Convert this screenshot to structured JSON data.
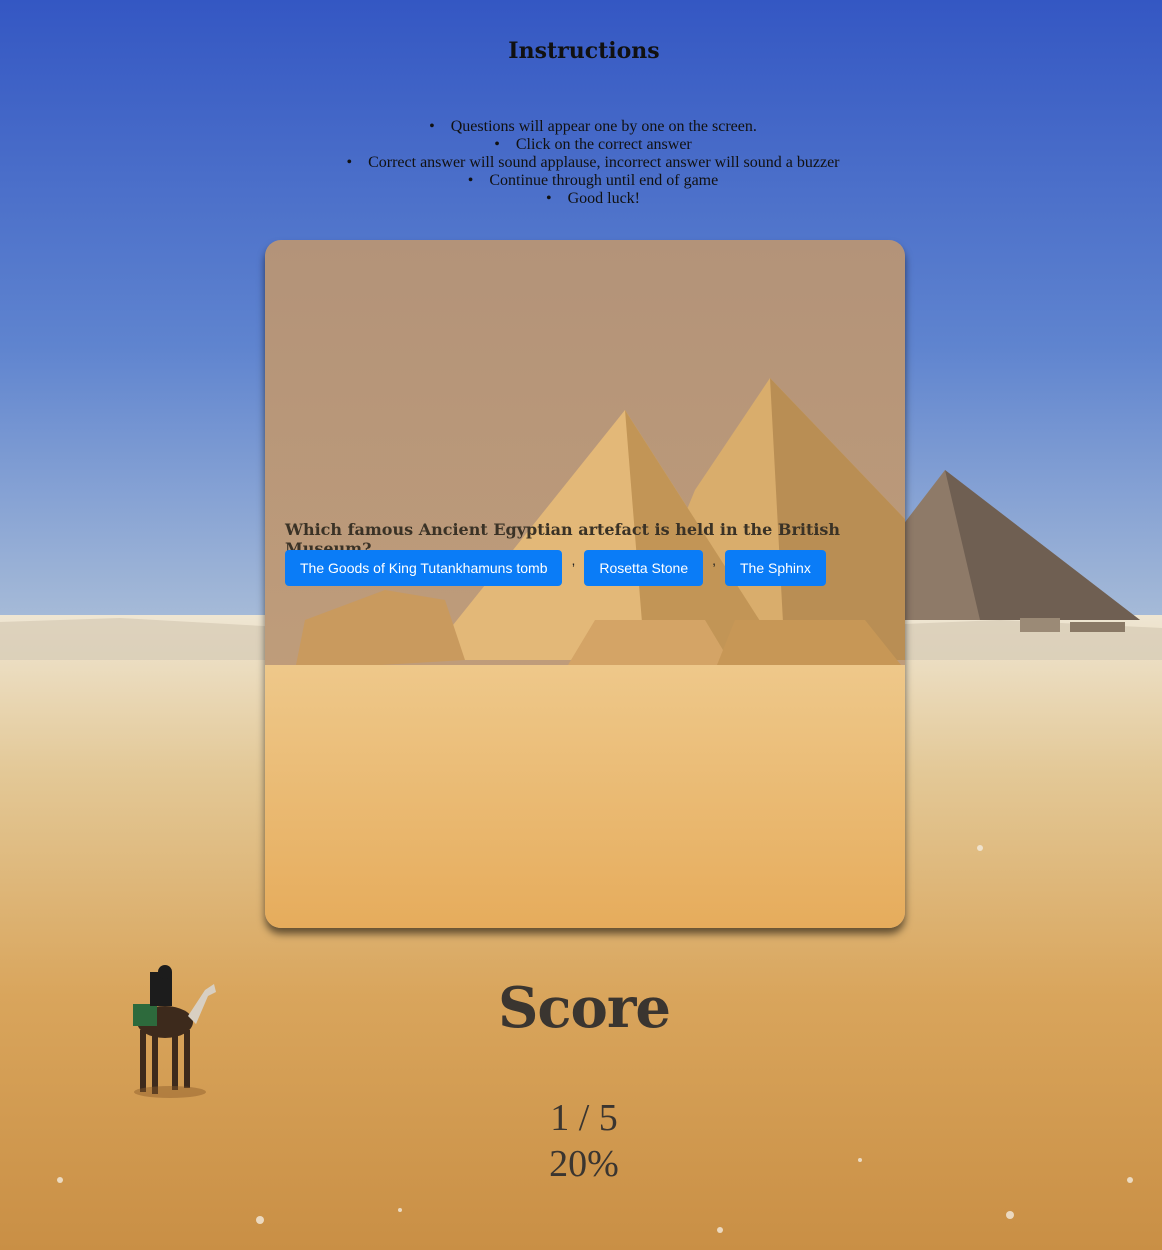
{
  "instructions": {
    "title": "Instructions",
    "items": [
      "Questions will appear one by one on the screen.",
      "Click on the correct answer",
      "Correct answer will sound applause, incorrect answer will sound a buzzer",
      "Continue through until end of game",
      "Good luck!"
    ]
  },
  "quiz": {
    "question": "Which famous Ancient Egyptian artefact is held in the British Museum?",
    "answers": [
      "The Goods of King Tutankhamuns tomb",
      "Rosetta Stone",
      "The Sphinx"
    ],
    "separator": ","
  },
  "score": {
    "title": "Score",
    "count": "1 / 5",
    "percent": "20%",
    "progress_fraction": 0.2
  },
  "colors": {
    "button": "#0a7cf7",
    "sky_top": "#3a5ec4",
    "sand": "#d9a55c"
  }
}
